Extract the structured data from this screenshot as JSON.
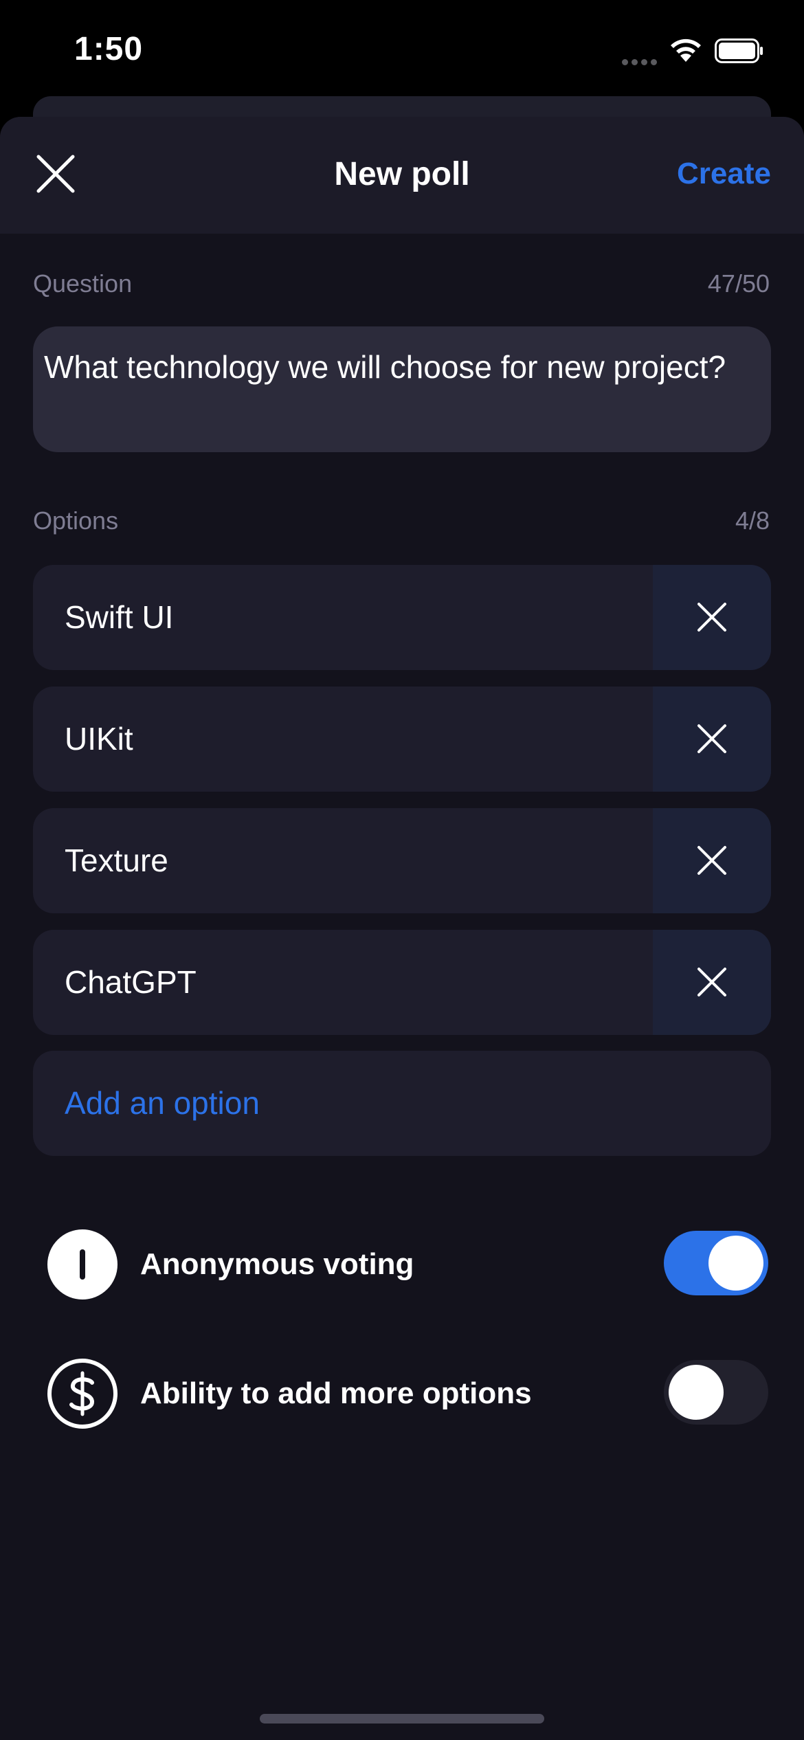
{
  "status_bar": {
    "time": "1:50"
  },
  "nav": {
    "title": "New poll",
    "create_label": "Create"
  },
  "question": {
    "label": "Question",
    "count": "47/50",
    "value": "What technology we will choose for new project?"
  },
  "options": {
    "label": "Options",
    "count": "4/8",
    "items": [
      {
        "label": "Swift UI"
      },
      {
        "label": "UIKit"
      },
      {
        "label": "Texture"
      },
      {
        "label": "ChatGPT"
      }
    ],
    "add_label": "Add an option"
  },
  "settings": [
    {
      "label": "Anonymous voting",
      "icon": "info-circle-icon",
      "enabled": true
    },
    {
      "label": "Ability to add more options",
      "icon": "dollar-circle-icon",
      "enabled": false
    }
  ],
  "colors": {
    "accent": "#2c72e8",
    "background": "#13121c",
    "card": "#1e1d2c",
    "input": "#2c2b3b",
    "muted": "#7f7d93"
  }
}
